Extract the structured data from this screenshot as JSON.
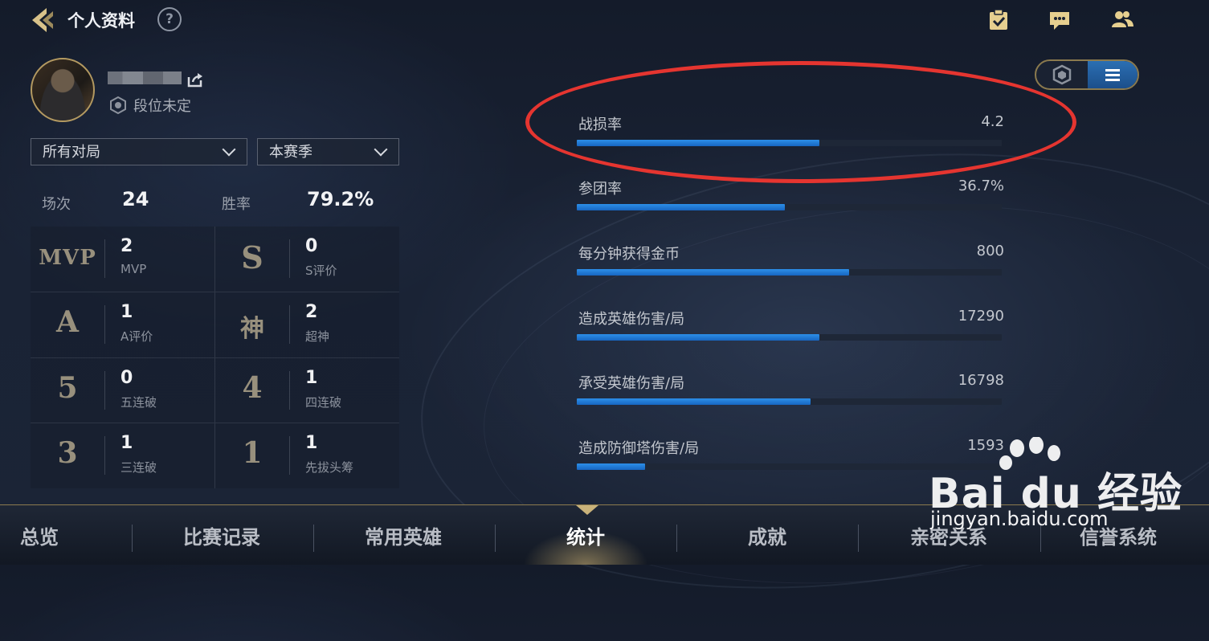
{
  "header": {
    "title": "个人资料",
    "help_glyph": "?",
    "icons": [
      "task-icon",
      "chat-icon",
      "friends-icon"
    ]
  },
  "profile": {
    "rank_text": "段位未定"
  },
  "filters": {
    "mode": "所有对局",
    "season": "本赛季"
  },
  "summary": {
    "matches_label": "场次",
    "matches_value": "24",
    "winrate_label": "胜率",
    "winrate_value": "79.2%"
  },
  "achievements": [
    {
      "glyph": "MVP",
      "value": "2",
      "label": "MVP"
    },
    {
      "glyph": "S",
      "value": "0",
      "label": "S评价"
    },
    {
      "glyph": "A",
      "value": "1",
      "label": "A评价"
    },
    {
      "glyph": "神",
      "value": "2",
      "label": "超神"
    },
    {
      "glyph": "5",
      "value": "0",
      "label": "五连破"
    },
    {
      "glyph": "4",
      "value": "1",
      "label": "四连破"
    },
    {
      "glyph": "3",
      "value": "1",
      "label": "三连破"
    },
    {
      "glyph": "1",
      "value": "1",
      "label": "先拔头筹"
    }
  ],
  "stats": [
    {
      "label": "战损率",
      "value": "4.2",
      "fill": 0.57
    },
    {
      "label": "参团率",
      "value": "36.7%",
      "fill": 0.49
    },
    {
      "label": "每分钟获得金币",
      "value": "800",
      "fill": 0.64
    },
    {
      "label": "造成英雄伤害/局",
      "value": "17290",
      "fill": 0.57
    },
    {
      "label": "承受英雄伤害/局",
      "value": "16798",
      "fill": 0.55
    },
    {
      "label": "造成防御塔伤害/局",
      "value": "1593",
      "fill": 0.16
    }
  ],
  "tabs": [
    "总览",
    "比赛记录",
    "常用英雄",
    "统计",
    "成就",
    "亲密关系",
    "信誉系统"
  ],
  "active_tab": "统计",
  "watermark": {
    "brand": "Bai du 经验",
    "url": "jingyan.baidu.com"
  },
  "colors": {
    "accent_blue": "#2c8fe8",
    "gold": "#b49a61",
    "annotation_red": "#e53530"
  }
}
